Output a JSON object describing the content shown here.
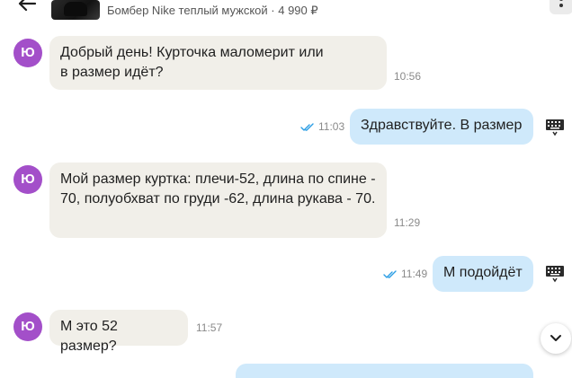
{
  "header": {
    "product_title": "Бомбер Nike теплый мужской · 4 990 ₽"
  },
  "avatar_letter": "Ю",
  "messages": [
    {
      "direction": "in",
      "text": "Добрый день! Курточка маломерит или в размер идёт?",
      "time": "10:56"
    },
    {
      "direction": "out",
      "text": "Здравствуйте. В размер",
      "time": "11:03",
      "status": "read"
    },
    {
      "direction": "in",
      "text": "Мой размер куртка:  плечи-52, длина по спине - 70, полуобхват по груди -62, длина рукава - 70.",
      "time": "11:29"
    },
    {
      "direction": "out",
      "text": "М подойдёт",
      "time": "11:49",
      "status": "read"
    },
    {
      "direction": "in",
      "text": "М это 52 размер?",
      "time": "11:57"
    }
  ],
  "colors": {
    "avatar": "#a34fc9",
    "incoming_bubble": "#f1efe9",
    "outgoing_bubble": "#cfe9fb",
    "read_check": "#2a9de4"
  },
  "icons": {
    "back": "arrow-left-icon",
    "menu": "more-vertical-icon",
    "read_status": "double-check-icon",
    "keyboard": "keyboard-icon",
    "scroll_down": "chevron-down-icon"
  }
}
